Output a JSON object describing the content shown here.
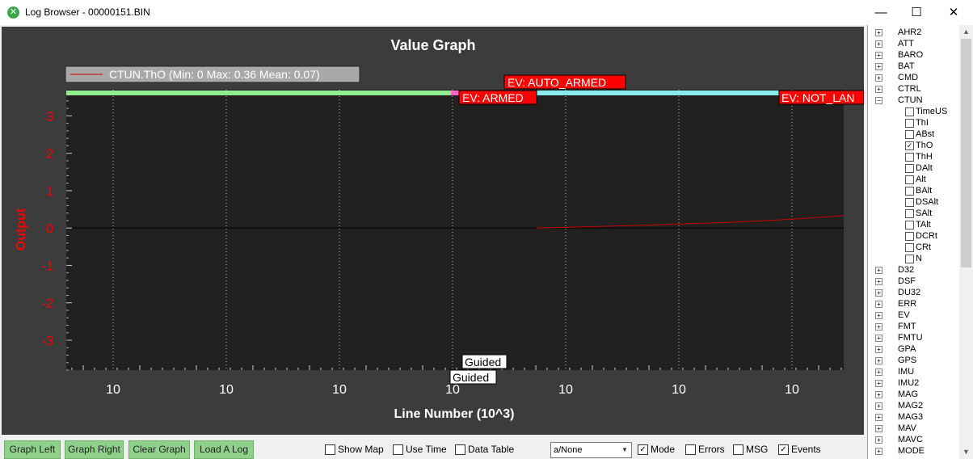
{
  "window": {
    "title": "Log Browser - 00000151.BIN",
    "minimize_glyph": "—",
    "maximize_glyph": "☐",
    "close_glyph": "✕"
  },
  "graph": {
    "title": "Value Graph",
    "legend": "CTUN.ThO (Min: 0 Max: 0.36 Mean: 0.07)",
    "events": {
      "auto_armed": "EV: AUTO_ARMED",
      "armed": "EV: ARMED",
      "not_landed": "EV: NOT_LAN"
    },
    "mode_labels": [
      "Guided",
      "Guided"
    ],
    "colors": {
      "series": "#cc0000",
      "mode_green": "#90ee90",
      "mode_pink": "#ff66cc",
      "mode_cyan": "#87ebee",
      "axis_label": "#ff0000"
    }
  },
  "chart_data": {
    "type": "line",
    "title": "Value Graph",
    "xlabel": "Line Number (10^3)",
    "ylabel": "Output",
    "x_tick_labels": [
      "10",
      "10",
      "10",
      "10",
      "10",
      "10",
      "10"
    ],
    "y_ticks": [
      3,
      2,
      1,
      0,
      -1,
      -2,
      -3
    ],
    "ylim": [
      -3.8,
      3.7
    ],
    "grid": true,
    "legend_position": "top-left",
    "series": [
      {
        "name": "CTUN.ThO",
        "color": "#cc0000",
        "points": [
          [
            0.605,
            0.0
          ],
          [
            0.65,
            0.02
          ],
          [
            0.75,
            0.08
          ],
          [
            0.85,
            0.15
          ],
          [
            0.92,
            0.22
          ],
          [
            1.0,
            0.33
          ]
        ]
      }
    ]
  },
  "tree": {
    "groups_top": [
      {
        "label": "AHR2",
        "sign": "+"
      },
      {
        "label": "ATT",
        "sign": "+"
      },
      {
        "label": "BARO",
        "sign": "+"
      },
      {
        "label": "BAT",
        "sign": "+"
      },
      {
        "label": "CMD",
        "sign": "+"
      },
      {
        "label": "CTRL",
        "sign": "+"
      },
      {
        "label": "CTUN",
        "sign": "−"
      }
    ],
    "ctun_children": [
      {
        "label": "TimeUS",
        "checked": false
      },
      {
        "label": "ThI",
        "checked": false
      },
      {
        "label": "ABst",
        "checked": false
      },
      {
        "label": "ThO",
        "checked": true
      },
      {
        "label": "ThH",
        "checked": false
      },
      {
        "label": "DAlt",
        "checked": false
      },
      {
        "label": "Alt",
        "checked": false
      },
      {
        "label": "BAlt",
        "checked": false
      },
      {
        "label": "DSAlt",
        "checked": false
      },
      {
        "label": "SAlt",
        "checked": false
      },
      {
        "label": "TAlt",
        "checked": false
      },
      {
        "label": "DCRt",
        "checked": false
      },
      {
        "label": "CRt",
        "checked": false
      },
      {
        "label": "N",
        "checked": false
      }
    ],
    "groups_bottom": [
      {
        "label": "D32",
        "sign": "+"
      },
      {
        "label": "DSF",
        "sign": "+"
      },
      {
        "label": "DU32",
        "sign": "+"
      },
      {
        "label": "ERR",
        "sign": "+"
      },
      {
        "label": "EV",
        "sign": "+"
      },
      {
        "label": "FMT",
        "sign": "+"
      },
      {
        "label": "FMTU",
        "sign": "+"
      },
      {
        "label": "GPA",
        "sign": "+"
      },
      {
        "label": "GPS",
        "sign": "+"
      },
      {
        "label": "IMU",
        "sign": "+"
      },
      {
        "label": "IMU2",
        "sign": "+"
      },
      {
        "label": "MAG",
        "sign": "+"
      },
      {
        "label": "MAG2",
        "sign": "+"
      },
      {
        "label": "MAG3",
        "sign": "+"
      },
      {
        "label": "MAV",
        "sign": "+"
      },
      {
        "label": "MAVC",
        "sign": "+"
      },
      {
        "label": "MODE",
        "sign": "+"
      }
    ],
    "check_glyph": "✓",
    "scroll_up": "▲",
    "scroll_down": "▼"
  },
  "toolbar": {
    "graph_left": "Graph Left",
    "graph_right": "Graph Right",
    "clear_graph": "Clear Graph",
    "load_log": "Load A Log",
    "show_map": {
      "label": "Show Map",
      "checked": false
    },
    "use_time": {
      "label": "Use Time",
      "checked": false
    },
    "data_table": {
      "label": "Data Table",
      "checked": false
    },
    "dropdown_value": "a/None",
    "dropdown_arrow": "▼",
    "mode": {
      "label": "Mode",
      "checked": true
    },
    "errors": {
      "label": "Errors",
      "checked": false
    },
    "msg": {
      "label": "MSG",
      "checked": false
    },
    "events": {
      "label": "Events",
      "checked": true
    }
  }
}
